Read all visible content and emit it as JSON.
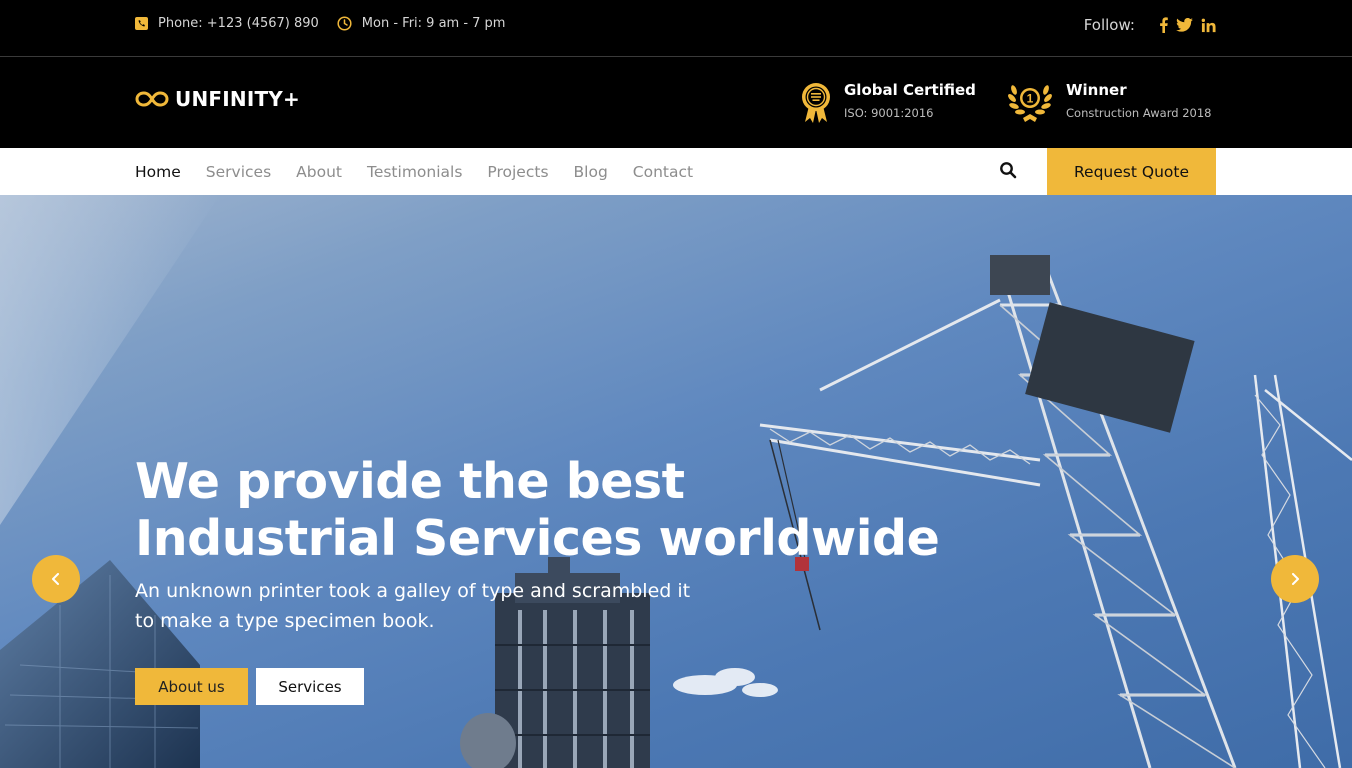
{
  "topbar": {
    "phone": "Phone: +123 (4567) 890",
    "hours": "Mon - Fri: 9 am - 7 pm",
    "follow_label": "Follow:",
    "social": [
      "f",
      "twitter",
      "in"
    ]
  },
  "header": {
    "logo": "UNFINITY+",
    "awards": [
      {
        "title": "Global Certified",
        "subtitle": "ISO: 9001:2016",
        "icon": "certificate-badge-icon"
      },
      {
        "title": "Winner",
        "subtitle": "Construction Award 2018",
        "icon": "laurel-number-one-icon"
      }
    ]
  },
  "nav": {
    "items": [
      "Home",
      "Services",
      "About",
      "Testimonials",
      "Projects",
      "Blog",
      "Contact"
    ],
    "active": "Home",
    "cta": "Request Quote"
  },
  "hero": {
    "headline_line1": "We provide the best",
    "headline_line2": "Industrial Services worldwide",
    "subtext_line1": "An unknown printer took a galley of type and scrambled it",
    "subtext_line2": "to make a type specimen book.",
    "primary_button": "About us",
    "secondary_button": "Services"
  },
  "colors": {
    "accent": "#f0b83a",
    "dark": "#000000",
    "white": "#ffffff"
  }
}
